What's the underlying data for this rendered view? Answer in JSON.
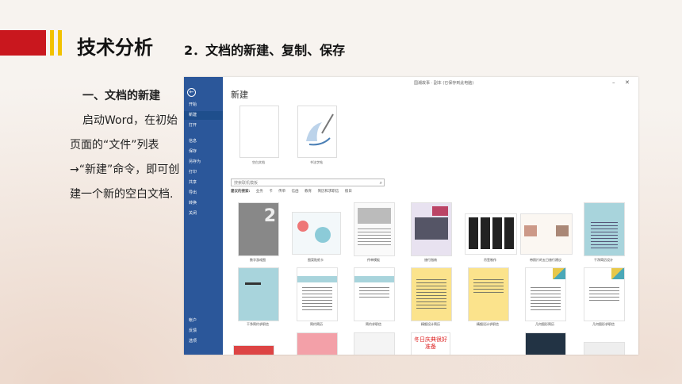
{
  "slide": {
    "section_title": "技术分析",
    "subtitle": "2．文档的新建、复制、保存",
    "heading": "一、文档的新建",
    "body": "启动Word，在初始页面的“文件”列表→“新建”命令，即可创建一个新的空白文档."
  },
  "word": {
    "window_title": "国潮故事 · 副本 (已保存到此电脑)",
    "sidebar": [
      "开始",
      "新建",
      "打开",
      "信息",
      "保存",
      "另存为",
      "打印",
      "共享",
      "导出",
      "转换",
      "关闭"
    ],
    "sidebar_bottom": [
      "帐户",
      "反馈",
      "选项"
    ],
    "new_title": "新建",
    "featured": [
      "空白文档",
      "书法字帖"
    ],
    "search_placeholder": "搜索联机模板",
    "suggest_label": "建议的搜索:",
    "suggestions": [
      "业务",
      "卡",
      "传单",
      "信函",
      "教育",
      "简历和求职信",
      "假日"
    ],
    "templates_row1": [
      "数字游戏图",
      "图案贴纸卡",
      "传单模板",
      "旅行指南",
      "吊签制作",
      "带照片的五日旅行建议",
      "干净简历设计"
    ],
    "templates_row2": [
      "干净简约求职信",
      "简约简历",
      "简约求职信",
      "精细设计简历",
      "精细设计求职信",
      "几何图形简历",
      "几何图形求职信"
    ],
    "row3_banner": "冬日庆典很好准备",
    "colors": {
      "sidebar": "#2b579a",
      "accent_red": "#c9171e",
      "accent_yellow": "#f2c200"
    }
  }
}
